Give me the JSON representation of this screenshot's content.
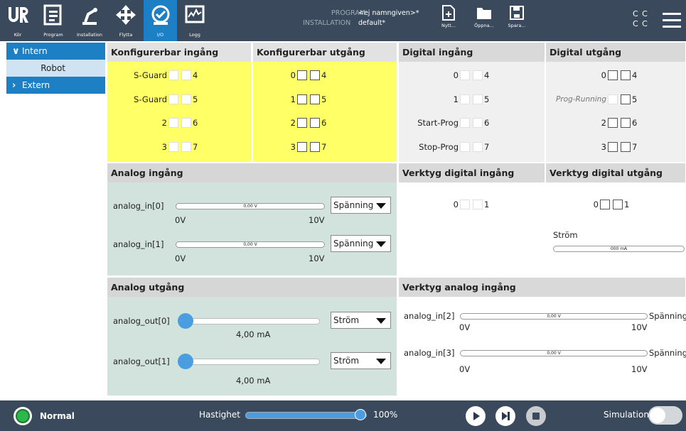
{
  "nav": {
    "items": [
      {
        "label": "Kör",
        "icon": "ur-logo-icon"
      },
      {
        "label": "Program",
        "icon": "program-icon"
      },
      {
        "label": "Installation",
        "icon": "robot-arm-icon"
      },
      {
        "label": "Flytta",
        "icon": "move-arrows-icon"
      },
      {
        "label": "I/O",
        "icon": "io-icon"
      },
      {
        "label": "Logg",
        "icon": "log-icon"
      }
    ],
    "active": "I/O"
  },
  "header": {
    "program_label": "PROGRAM",
    "program_value": "<ej namngiven>*",
    "installation_label": "INSTALLATION",
    "installation_value": "default*",
    "new_label": "Nytt...",
    "open_label": "Öppna...",
    "save_label": "Spara...",
    "cc_top": "C C",
    "cc_bottom": "C C"
  },
  "sidebar": {
    "intern": "Intern",
    "robot": "Robot",
    "extern": "Extern"
  },
  "conf_in": {
    "title": "Konfigurerbar ingång",
    "rows": [
      {
        "left": "S-Guard",
        "right": "4"
      },
      {
        "left": "S-Guard",
        "right": "5"
      },
      {
        "left": "2",
        "right": "6"
      },
      {
        "left": "3",
        "right": "7"
      }
    ]
  },
  "conf_out": {
    "title": "Konfigurerbar utgång",
    "rows": [
      {
        "left": "0",
        "right": "4"
      },
      {
        "left": "1",
        "right": "5"
      },
      {
        "left": "2",
        "right": "6"
      },
      {
        "left": "3",
        "right": "7"
      }
    ]
  },
  "dig_in": {
    "title": "Digital ingång",
    "rows": [
      {
        "left": "0",
        "right": "4"
      },
      {
        "left": "1",
        "right": "5"
      },
      {
        "left": "Start-Prog",
        "right": "6"
      },
      {
        "left": "Stop-Prog",
        "right": "7"
      }
    ]
  },
  "dig_out": {
    "title": "Digital utgång",
    "rows": [
      {
        "left": "0",
        "right": "4"
      },
      {
        "left": "Prog-Running",
        "right": "5"
      },
      {
        "left": "2",
        "right": "6"
      },
      {
        "left": "3",
        "right": "7"
      }
    ]
  },
  "analog_in": {
    "title": "Analog ingång",
    "ch0": {
      "label": "analog_in[0]",
      "value": "0,00 V",
      "mode": "Spänning",
      "min": "0V",
      "max": "10V"
    },
    "ch1": {
      "label": "analog_in[1]",
      "value": "0,00 V",
      "mode": "Spänning",
      "min": "0V",
      "max": "10V"
    }
  },
  "tool_dig_in": {
    "title": "Verktyg digital ingång",
    "left": "0",
    "right": "1"
  },
  "tool_dig_out": {
    "title": "Verktyg digital utgång",
    "left": "0",
    "right": "1",
    "current_label": "Ström",
    "current_value": "000 mA"
  },
  "analog_out": {
    "title": "Analog utgång",
    "ch0": {
      "label": "analog_out[0]",
      "value": "4,00 mA",
      "mode": "Ström",
      "level": 0
    },
    "ch1": {
      "label": "analog_out[1]",
      "value": "4,00 mA",
      "mode": "Ström",
      "level": 0
    }
  },
  "tool_analog_in": {
    "title": "Verktyg analog ingång",
    "ch2": {
      "label": "analog_in[2]",
      "value": "0,00 V",
      "mode": "Spänning",
      "min": "0V",
      "max": "10V"
    },
    "ch3": {
      "label": "analog_in[3]",
      "value": "0,00 V",
      "mode": "Spänning",
      "min": "0V",
      "max": "10V"
    }
  },
  "footer": {
    "status": "Normal",
    "speed_label": "Hastighet",
    "speed_value": "100%",
    "speed_level": 1.0,
    "simulation_label": "Simulation",
    "status_color": "#2db84b"
  }
}
